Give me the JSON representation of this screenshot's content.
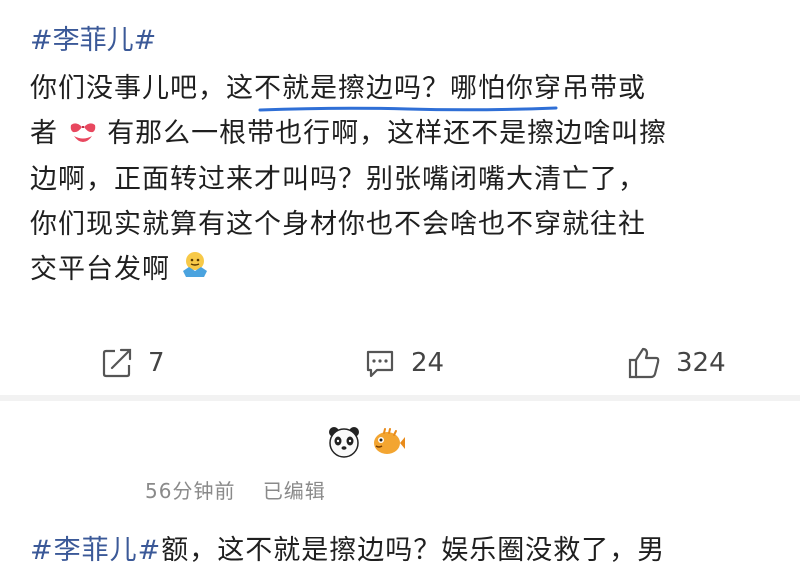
{
  "post": {
    "hashtag": "#李菲儿#",
    "lines": [
      "你们没事儿吧，这不就是擦边吗？哪怕你穿吊带或",
      "有那么一根带也行啊，这样还不是擦边啥叫擦",
      "边啊，正面转过来才叫吗？别张嘴闭嘴大清亡了，",
      "你们现实就算有这个身材你也不会啥也不穿就往社",
      "交平台发啊"
    ],
    "line2_prefix": "者",
    "actions": {
      "repost_count": "7",
      "comment_count": "24",
      "like_count": "324"
    }
  },
  "comment": {
    "meta": {
      "time": "56分钟前",
      "edited": "已编辑"
    },
    "hashtag": "#李菲儿#",
    "text": "额，这不就是擦边吗？娱乐圈没救了，男"
  },
  "icons": [
    "bikini-emoji-icon",
    "shrug-emoji-icon",
    "repost-icon",
    "comment-icon",
    "like-icon",
    "panda-emoji-icon",
    "pufferfish-emoji-icon"
  ],
  "colors": {
    "hashtag": "#3b5998",
    "underline": "#2f6fd6",
    "meta": "#8a8a8a"
  }
}
